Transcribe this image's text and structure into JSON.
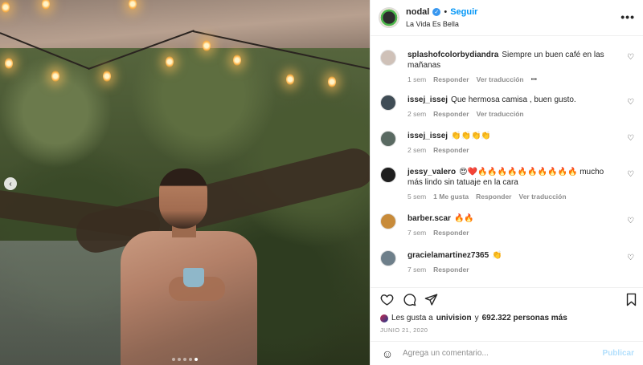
{
  "header": {
    "username": "nodal",
    "separator": "•",
    "follow_label": "Seguir",
    "subtitle": "La Vida Es Bella",
    "more_icon": "more-horizontal-icon"
  },
  "comments": [
    {
      "user": "splashofcolorbydiandra",
      "text": "Siempre un buen café en las mañanas",
      "time": "1 sem",
      "likes": "",
      "reply": "Responder",
      "translate": "Ver traducción",
      "has_more": true
    },
    {
      "user": "issej_issej",
      "text": "Que hermosa camisa , buen gusto.",
      "time": "2 sem",
      "likes": "",
      "reply": "Responder",
      "translate": "Ver traducción",
      "has_more": false
    },
    {
      "user": "issej_issej",
      "text": "👏👏👏👏",
      "time": "2 sem",
      "likes": "",
      "reply": "Responder",
      "translate": "",
      "has_more": false
    },
    {
      "user": "jessy_valero",
      "text": "😍❤️🔥🔥🔥🔥🔥🔥🔥🔥🔥🔥 mucho más lindo sin tatuaje en la cara",
      "time": "5 sem",
      "likes": "1 Me gusta",
      "reply": "Responder",
      "translate": "Ver traducción",
      "has_more": false
    },
    {
      "user": "barber.scar",
      "text": "🔥🔥",
      "time": "7 sem",
      "likes": "",
      "reply": "Responder",
      "translate": "",
      "has_more": false
    },
    {
      "user": "gracielamartinez7365",
      "text": "👏",
      "time": "7 sem",
      "likes": "",
      "reply": "Responder",
      "translate": "",
      "has_more": false
    }
  ],
  "likes": {
    "prefix": "Les gusta a",
    "user": "univision",
    "joiner": "y",
    "count": "692.322 personas más"
  },
  "date": "JUNIO 21, 2020",
  "composer": {
    "placeholder": "Agrega un comentario...",
    "publish_label": "Publicar"
  },
  "carousel": {
    "slide_count": 5,
    "active_index": 4
  },
  "colors": {
    "accent": "#0095f6",
    "publish_disabled": "#b2dffc",
    "meta_gray": "#8e8e8e"
  }
}
